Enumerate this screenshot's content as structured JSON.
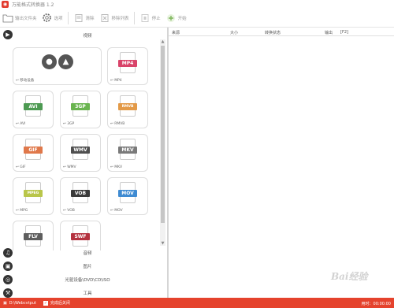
{
  "window": {
    "title": "万能格式转换器 1.2"
  },
  "toolbar": {
    "output_folder": "输出文件夹",
    "options": "选项",
    "clear": "清除",
    "remove": "移除列表",
    "stop": "停止",
    "start": "开始"
  },
  "sidebar": {
    "video": "视频",
    "audio": "音频",
    "image": "图片",
    "disc": "光驱设备\\DVD\\CD\\ISO",
    "tools": "工具"
  },
  "formats": [
    {
      "tag": "",
      "caption": "移动设备",
      "color": "#555555"
    },
    {
      "tag": "MP4",
      "caption": "MP4",
      "color": "#d9446a"
    },
    {
      "tag": "AVI",
      "caption": "AVI",
      "color": "#4d9a52"
    },
    {
      "tag": "3GP",
      "caption": "3GP",
      "color": "#69b44f"
    },
    {
      "tag": "RMVB",
      "caption": "RMVB",
      "color": "#e39a48"
    },
    {
      "tag": "GIF",
      "caption": "GIF",
      "color": "#e0784a"
    },
    {
      "tag": "WMV",
      "caption": "WMV",
      "color": "#4f4f4f"
    },
    {
      "tag": "MKV",
      "caption": "MKV",
      "color": "#7a7a7a"
    },
    {
      "tag": "MPEG",
      "caption": "MPG",
      "color": "#b9c64a"
    },
    {
      "tag": "VOB",
      "caption": "VOB",
      "color": "#3a3a3a"
    },
    {
      "tag": "MOV",
      "caption": "MOV",
      "color": "#3f8bd2"
    },
    {
      "tag": "FLV",
      "caption": "",
      "color": "#5e5e5e"
    },
    {
      "tag": "SWF",
      "caption": "",
      "color": "#b4323f"
    }
  ],
  "table": {
    "headers": [
      "来源",
      "大小",
      "转换状态",
      "输出",
      "[F2]"
    ]
  },
  "status": {
    "output_path": "D:\\Webcvtput",
    "shutdown": "完成后关闭",
    "time": "用时：00:00:00"
  },
  "colors": {
    "accent": "#e5432d"
  }
}
